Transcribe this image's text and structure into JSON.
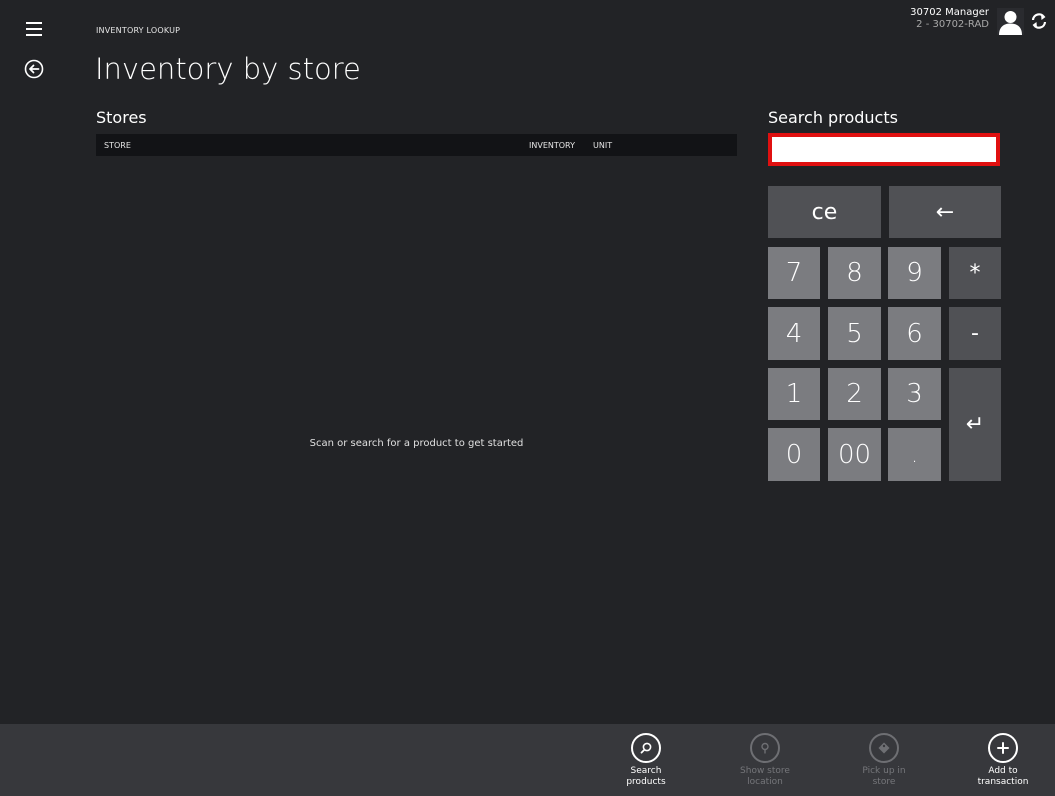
{
  "header": {
    "breadcrumb": "INVENTORY LOOKUP",
    "title": "Inventory by store",
    "user_name": "30702 Manager",
    "user_store": "2 - 30702-RAD"
  },
  "icons": {
    "menu": "hamburger-menu-icon",
    "back": "back-arrow-icon",
    "avatar": "user-avatar-icon",
    "sync": "sync-icon"
  },
  "stores": {
    "title": "Stores",
    "columns": [
      "STORE",
      "INVENTORY",
      "UNIT"
    ],
    "rows": [],
    "empty_message": "Scan or search for a product to get started"
  },
  "search": {
    "title": "Search products",
    "value": "",
    "placeholder": ""
  },
  "keypad": {
    "ce": "ce",
    "backspace": "←",
    "k7": "7",
    "k8": "8",
    "k9": "9",
    "star": "*",
    "k4": "4",
    "k5": "5",
    "k6": "6",
    "minus": "-",
    "k1": "1",
    "k2": "2",
    "k3": "3",
    "enter": "↵",
    "k0": "0",
    "k00": "00",
    "dot": "."
  },
  "appbar": {
    "search_products": "Search\nproducts",
    "show_store_location": "Show store\nlocation",
    "pick_up_in_store": "Pick up in\nstore",
    "add_to_transaction": "Add to\ntransaction"
  },
  "colors": {
    "background": "#222326",
    "appbar": "#37383c",
    "key_number": "#7b7c80",
    "key_operator": "#505155",
    "input_border": "#e01010"
  }
}
